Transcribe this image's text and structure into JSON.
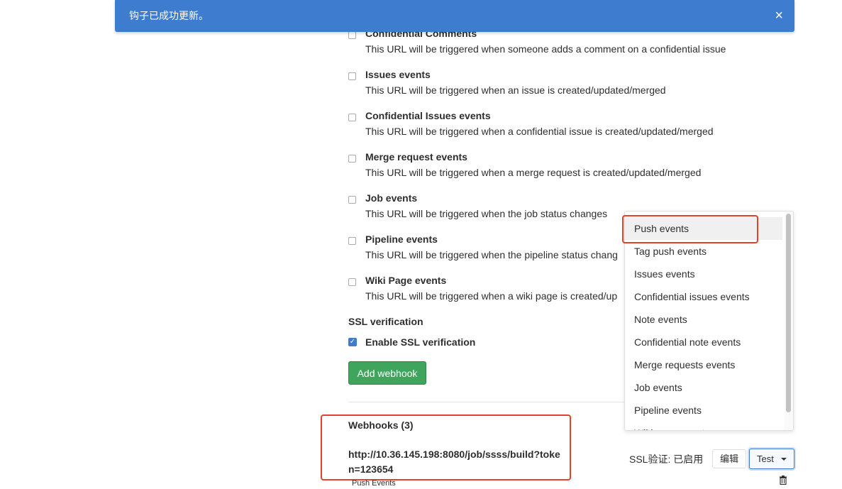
{
  "flash": {
    "message": "钩子已成功更新。",
    "close": "×"
  },
  "triggers": [
    {
      "title": "Confidential Comments",
      "desc": "This URL will be triggered when someone adds a comment on a confidential issue"
    },
    {
      "title": "Issues events",
      "desc": "This URL will be triggered when an issue is created/updated/merged"
    },
    {
      "title": "Confidential Issues events",
      "desc": "This URL will be triggered when a confidential issue is created/updated/merged"
    },
    {
      "title": "Merge request events",
      "desc": "This URL will be triggered when a merge request is created/updated/merged"
    },
    {
      "title": "Job events",
      "desc": "This URL will be triggered when the job status changes"
    },
    {
      "title": "Pipeline events",
      "desc": "This URL will be triggered when the pipeline status chang"
    },
    {
      "title": "Wiki Page events",
      "desc": "This URL will be triggered when a wiki page is created/up"
    }
  ],
  "ssl": {
    "heading": "SSL verification",
    "enable_label": "Enable SSL verification",
    "checked": true
  },
  "add_webhook_label": "Add webhook",
  "webhooks": {
    "title": "Webhooks (3)",
    "url": "http://10.36.145.198:8080/job/ssss/build?token=123654",
    "events": "Push Events",
    "ssl_status": "SSL验证: 已启用",
    "edit_label": "编辑",
    "test_label": "Test"
  },
  "dropdown": {
    "items": [
      "Push events",
      "Tag push events",
      "Issues events",
      "Confidential issues events",
      "Note events",
      "Confidential note events",
      "Merge requests events",
      "Job events",
      "Pipeline events",
      "Wiki page events"
    ]
  },
  "colors": {
    "banner": "#3e7ccf",
    "accent_green": "#3fa55c",
    "highlight_red": "#e2432a"
  }
}
